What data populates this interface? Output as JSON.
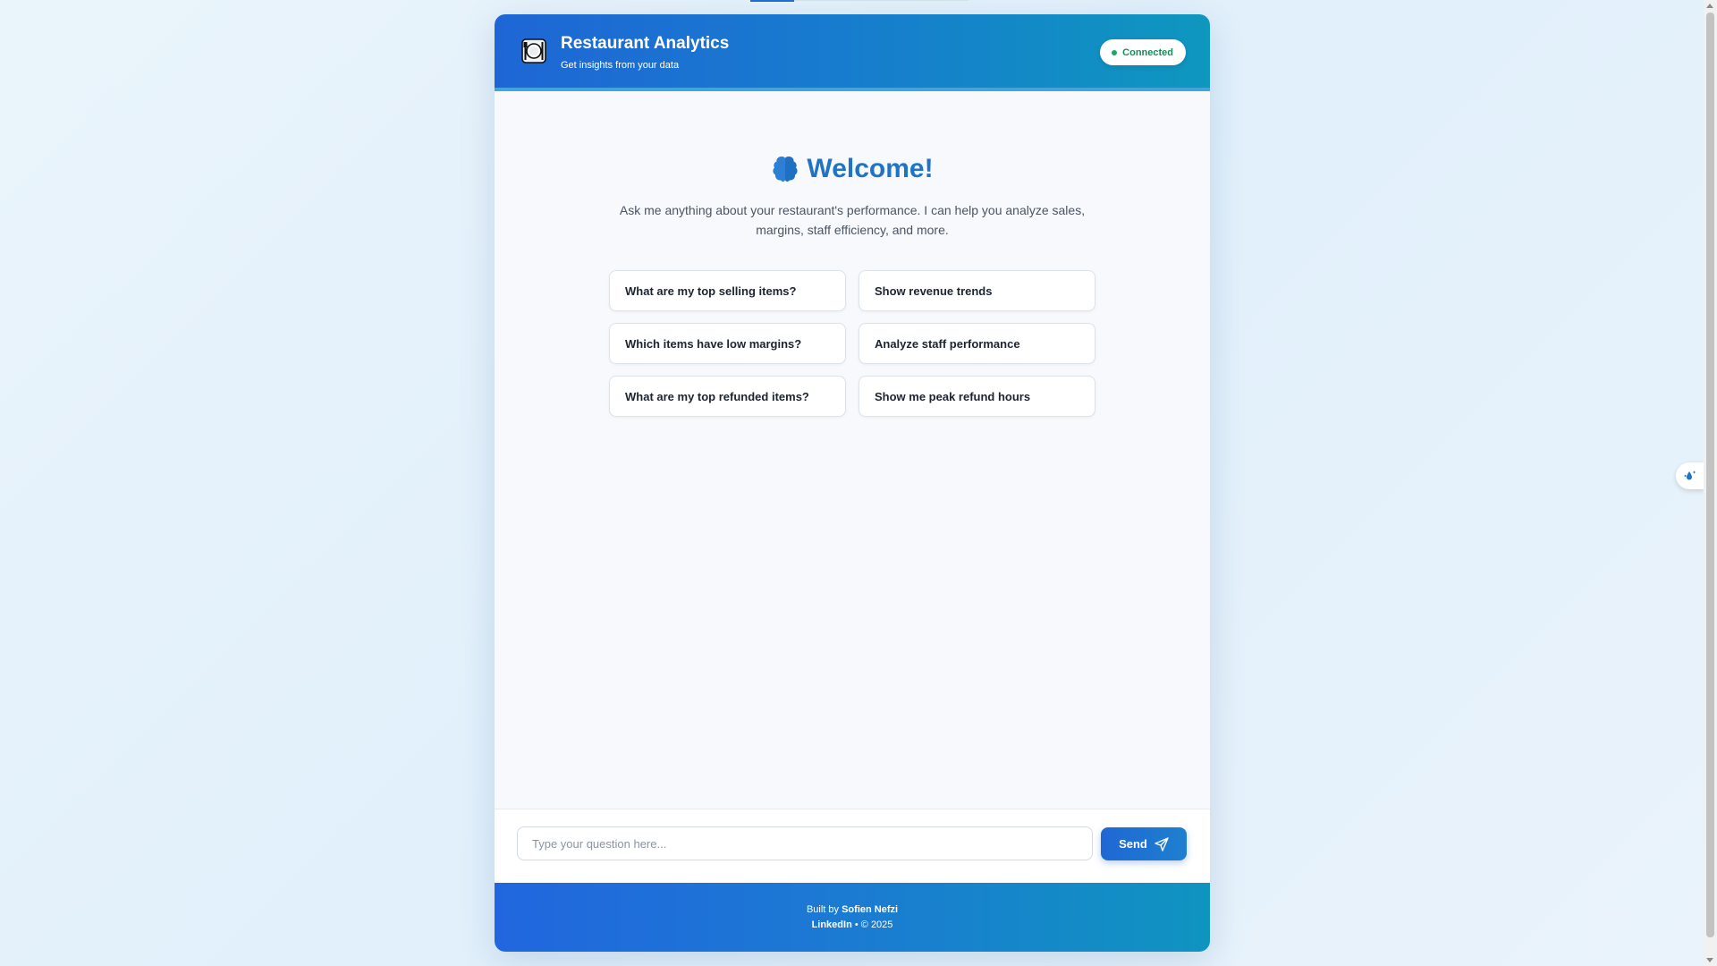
{
  "header": {
    "title": "Restaurant Analytics",
    "subtitle": "Get insights from your data",
    "logo_icon": "plate-cutlery-icon",
    "status": "Connected"
  },
  "welcome": {
    "icon": "brain-icon",
    "title": "Welcome!",
    "text": "Ask me anything about your restaurant's performance. I can help you analyze sales, margins, staff efficiency, and more."
  },
  "suggestions": [
    "What are my top selling items?",
    "Show revenue trends",
    "Which items have low margins?",
    "Analyze staff performance",
    "What are my top refunded items?",
    "Show me peak refund hours"
  ],
  "input": {
    "placeholder": "Type your question here...",
    "value": "",
    "send_label": "Send",
    "send_icon": "paper-plane-icon"
  },
  "footer": {
    "built_by_prefix": "Built by",
    "author": "Sofien Nefzi",
    "link": "LinkedIn",
    "separator": "•",
    "copyright": "© 2025"
  },
  "colors": {
    "header_gradient_start": "#1e66d6",
    "header_gradient_end": "#0e97bf",
    "accent": "#1f74c8",
    "status_green": "#1aa866",
    "page_background": "#eaf4fb"
  }
}
